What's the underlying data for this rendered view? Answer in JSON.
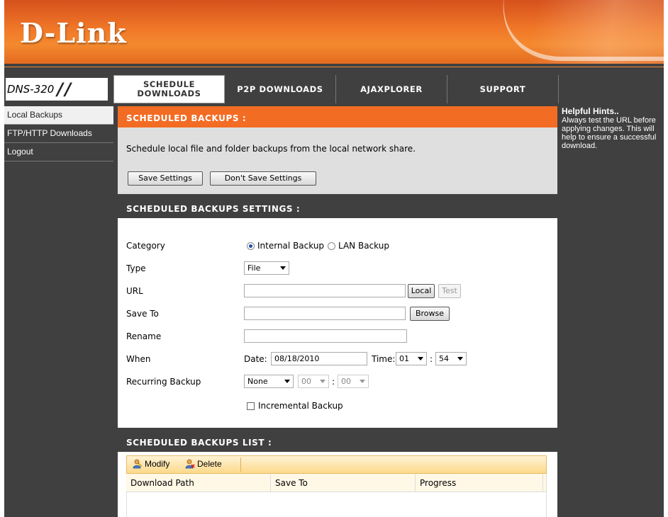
{
  "brand": {
    "logo": "D-Link",
    "model": "DNS-320"
  },
  "tabs": [
    {
      "label": "SCHEDULE DOWNLOADS",
      "active": true
    },
    {
      "label": "P2P DOWNLOADS",
      "active": false
    },
    {
      "label": "AJAXPLORER",
      "active": false
    },
    {
      "label": "SUPPORT",
      "active": false
    }
  ],
  "sidebar": {
    "items": [
      {
        "label": "Local Backups",
        "active": true
      },
      {
        "label": "FTP/HTTP Downloads",
        "active": false
      },
      {
        "label": "Logout",
        "active": false
      }
    ]
  },
  "hints": {
    "title": "Helpful Hints..",
    "text": "Always test the URL before applying changes. This will help to ensure a successful download."
  },
  "scheduled_backups": {
    "title": "SCHEDULED BACKUPS :",
    "description": "Schedule local file and folder backups from the local network share.",
    "save_label": "Save Settings",
    "dont_save_label": "Don't Save Settings"
  },
  "settings": {
    "title": "SCHEDULED BACKUPS SETTINGS :",
    "category_label": "Category",
    "category_options": [
      "Internal Backup",
      "LAN Backup"
    ],
    "category_selected": "Internal Backup",
    "type_label": "Type",
    "type_value": "File",
    "url_label": "URL",
    "url_value": "",
    "local_button": "Local",
    "test_button": "Test",
    "save_to_label": "Save To",
    "save_to_value": "",
    "browse_button": "Browse",
    "rename_label": "Rename",
    "rename_value": "",
    "when_label": "When",
    "date_label": "Date:",
    "date_value": "08/18/2010",
    "time_label": "Time:",
    "time_hour": "01",
    "time_sep": ":",
    "time_minute": "54",
    "recurring_label": "Recurring Backup",
    "recurring_value": "None",
    "recurring_hour": "00",
    "recurring_sep": ":",
    "recurring_minute": "00",
    "incremental_label": "Incremental Backup",
    "incremental_checked": false
  },
  "list": {
    "title": "SCHEDULED BACKUPS LIST :",
    "modify_label": "Modify",
    "delete_label": "Delete",
    "columns": [
      "Download Path",
      "Save To",
      "Progress"
    ],
    "rows": []
  },
  "colors": {
    "accent_orange": "#f26c24",
    "chrome_dark": "#404040",
    "panel_grey": "#dfdfdf"
  }
}
